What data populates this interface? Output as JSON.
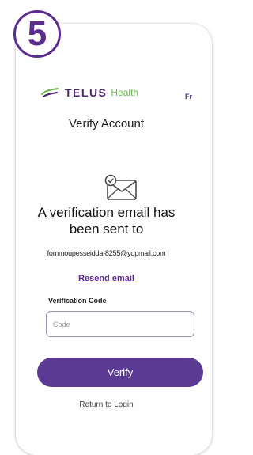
{
  "step_badge": "5",
  "header": {
    "brand": "TELUS",
    "brand_suffix": "Health",
    "language_toggle": "Fr"
  },
  "title": "Verify Account",
  "icons": {
    "logo": "telus-logo-icon",
    "mail": "verification-mail-icon"
  },
  "message": {
    "headline_line1": "A verification email has",
    "headline_line2": "been sent to",
    "email": "fommoupesseidda-8255@yopmail.com"
  },
  "resend_label": "Resend email",
  "form": {
    "code_label": "Verification Code",
    "code_placeholder": "Code",
    "code_value": ""
  },
  "verify_label": "Verify",
  "return_label": "Return to Login",
  "colors": {
    "brand_purple": "#4b286d",
    "button_purple": "#5b3a93",
    "badge_purple": "#5b2d8e",
    "brand_green": "#66bb44"
  }
}
